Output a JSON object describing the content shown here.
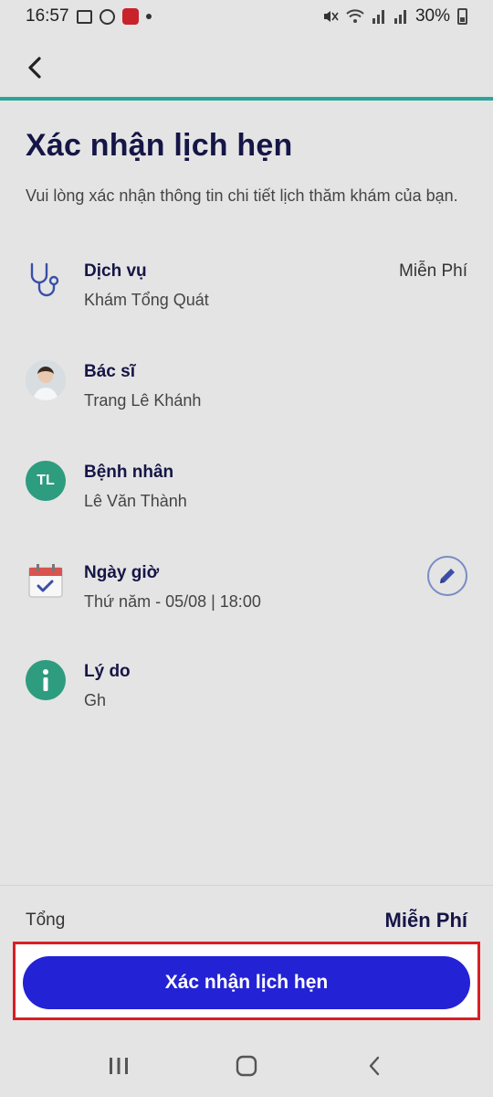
{
  "status_bar": {
    "time": "16:57",
    "battery": "30%"
  },
  "page": {
    "title": "Xác nhận lịch hẹn",
    "subtitle": "Vui lòng xác nhận thông tin chi tiết lịch thăm khám của bạn."
  },
  "details": {
    "service": {
      "label": "Dịch vụ",
      "value": "Khám Tổng Quát",
      "price": "Miễn Phí",
      "icon": "stethoscope-icon"
    },
    "doctor": {
      "label": "Bác sĩ",
      "value": "Trang Lê Khánh",
      "icon": "doctor-avatar"
    },
    "patient": {
      "label": "Bệnh nhân",
      "value": "Lê Văn Thành",
      "initials": "TL"
    },
    "datetime": {
      "label": "Ngày giờ",
      "value": "Thứ năm - 05/08 | 18:00",
      "icon": "calendar-check-icon"
    },
    "reason": {
      "label": "Lý do",
      "value": "Gh",
      "icon": "info-icon"
    }
  },
  "footer": {
    "total_label": "Tổng",
    "total_value": "Miễn Phí",
    "confirm_label": "Xác nhận lịch hẹn"
  },
  "colors": {
    "accent_teal": "#2aa59a",
    "primary_button": "#2322d4",
    "highlight_border": "#d81f26",
    "green_badge": "#2e9c7e"
  }
}
